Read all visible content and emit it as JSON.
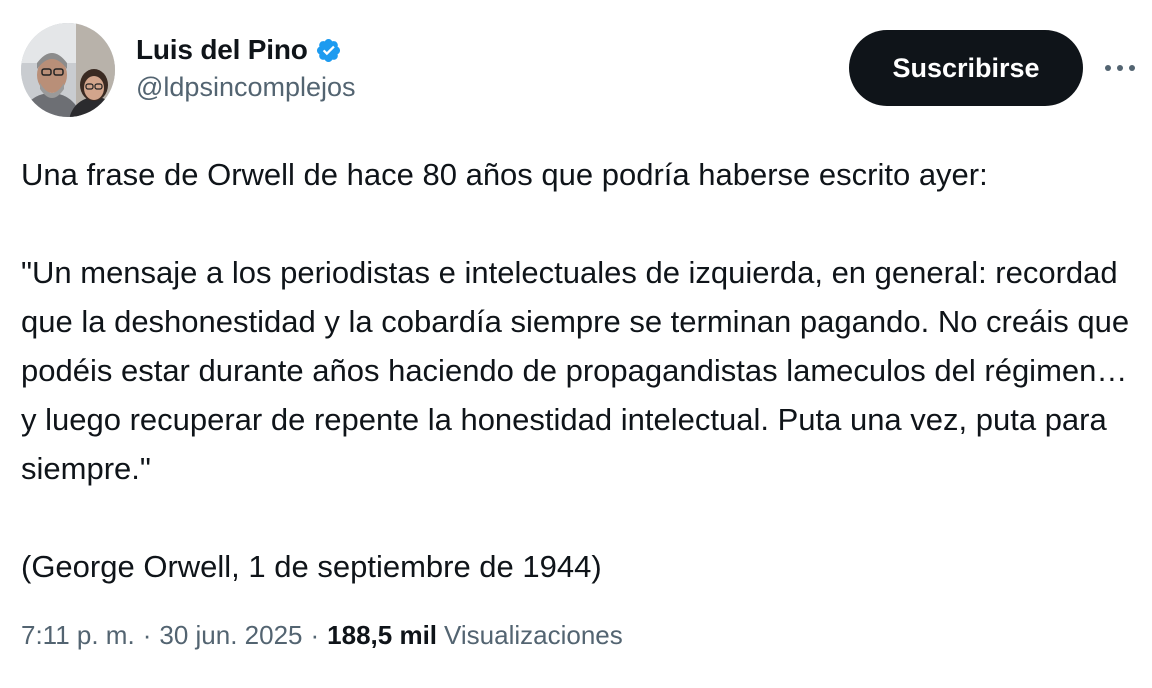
{
  "author": {
    "display_name": "Luis del Pino",
    "handle": "@ldpsincomplejos",
    "verified": true,
    "verified_color": "#1d9bf0"
  },
  "actions": {
    "subscribe_label": "Suscribirse",
    "more_icon": "more-horizontal-icon"
  },
  "tweet": {
    "paragraphs": [
      "Una frase de Orwell de hace 80 años que podría haberse escrito ayer:",
      "\"Un mensaje a los periodistas e intelectuales de izquierda, en general: recordad que la deshonestidad y la cobardía siempre se terminan pagando. No creáis que podéis estar durante años haciendo de propagandistas lameculos del régimen… y luego recuperar de repente la honestidad intelectual. Puta una vez, puta para siempre.\"",
      "(George Orwell, 1 de septiembre de 1944)"
    ]
  },
  "meta": {
    "time": "7:11 p. m.",
    "separator": "·",
    "date": "30 jun. 2025",
    "views_count": "188,5 mil",
    "views_label": "Visualizaciones"
  },
  "colors": {
    "text": "#0f1419",
    "secondary": "#536471",
    "button_bg": "#0f1419",
    "button_text": "#ffffff"
  }
}
